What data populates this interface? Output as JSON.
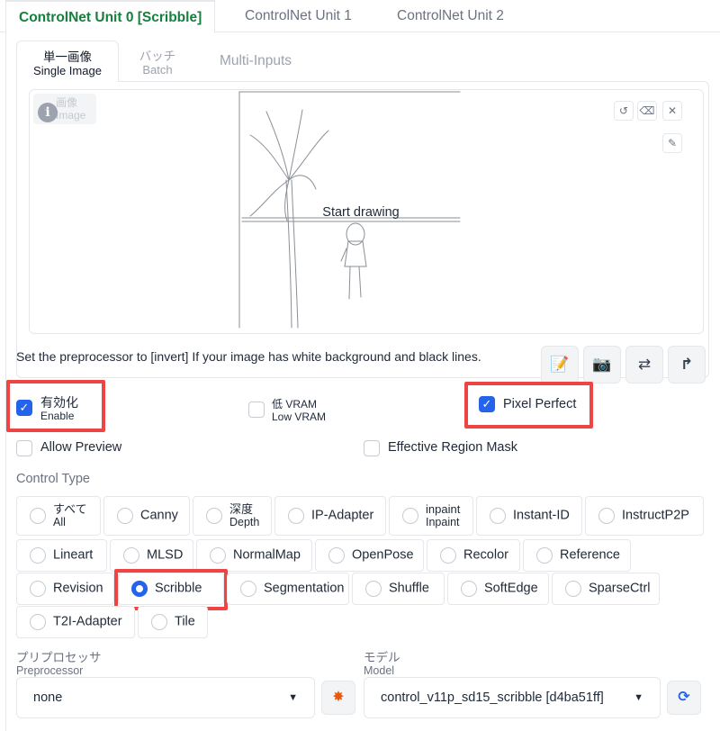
{
  "top_tabs": [
    {
      "label": "ControlNet Unit 0 [Scribble]",
      "active": true
    },
    {
      "label": "ControlNet Unit 1",
      "active": false
    },
    {
      "label": "ControlNet Unit 2",
      "active": false
    }
  ],
  "image_tabs": [
    {
      "jp": "単一画像",
      "en": "Single Image",
      "active": true
    },
    {
      "jp": "バッチ",
      "en": "Batch",
      "active": false
    },
    {
      "jp": "",
      "en": "Multi-Inputs",
      "active": false
    }
  ],
  "canvas": {
    "image_label_jp": "画像",
    "image_label_en": "Image",
    "placeholder": "Start drawing",
    "undo_icon": "undo-icon",
    "erase_icon": "eraser-icon",
    "close_icon": "close-icon",
    "brush_icon": "brush-icon"
  },
  "hint": "Set the preprocessor to [invert] If your image has white background and black lines.",
  "tool_buttons": [
    {
      "icon": "edit-icon",
      "glyph": "📝"
    },
    {
      "icon": "camera-icon",
      "glyph": "📷"
    },
    {
      "icon": "swap-icon",
      "glyph": "⇄"
    },
    {
      "icon": "upload-icon",
      "glyph": "↱"
    }
  ],
  "options": {
    "enable": {
      "jp": "有効化",
      "en": "Enable",
      "checked": true
    },
    "low_vram": {
      "jp": "低 VRAM",
      "en": "Low VRAM",
      "checked": false
    },
    "pixel_perfect": {
      "label": "Pixel Perfect",
      "checked": true
    },
    "allow_preview": {
      "label": "Allow Preview",
      "checked": false
    },
    "effective_region_mask": {
      "label": "Effective Region Mask",
      "checked": false
    }
  },
  "control_type": {
    "label": "Control Type",
    "selected": "Scribble",
    "rows": [
      [
        {
          "jp": "すべて",
          "en": "All"
        },
        {
          "label": "Canny"
        },
        {
          "jp": "深度",
          "en": "Depth"
        },
        {
          "label": "IP-Adapter"
        },
        {
          "jp": "inpaint",
          "en": "Inpaint"
        },
        {
          "label": "Instant-ID"
        },
        {
          "label": "InstructP2P"
        }
      ],
      [
        {
          "label": "Lineart"
        },
        {
          "label": "MLSD"
        },
        {
          "label": "NormalMap"
        },
        {
          "label": "OpenPose"
        },
        {
          "label": "Recolor"
        },
        {
          "label": "Reference"
        }
      ],
      [
        {
          "label": "Revision"
        },
        {
          "label": "Scribble"
        },
        {
          "label": "Segmentation"
        },
        {
          "label": "Shuffle"
        },
        {
          "label": "SoftEdge"
        },
        {
          "label": "SparseCtrl"
        }
      ],
      [
        {
          "label": "T2I-Adapter"
        },
        {
          "label": "Tile"
        }
      ]
    ]
  },
  "preprocessor": {
    "label_jp": "プリプロセッサ",
    "label_en": "Preprocessor",
    "value": "none",
    "run_icon": "explosion-icon"
  },
  "model": {
    "label_jp": "モデル",
    "label_en": "Model",
    "value": "control_v11p_sd15_scribble [d4ba51ff]",
    "refresh_icon": "refresh-icon"
  },
  "colors": {
    "accent": "#2563eb",
    "active_tab": "#15803d",
    "highlight": "#ef4444"
  }
}
